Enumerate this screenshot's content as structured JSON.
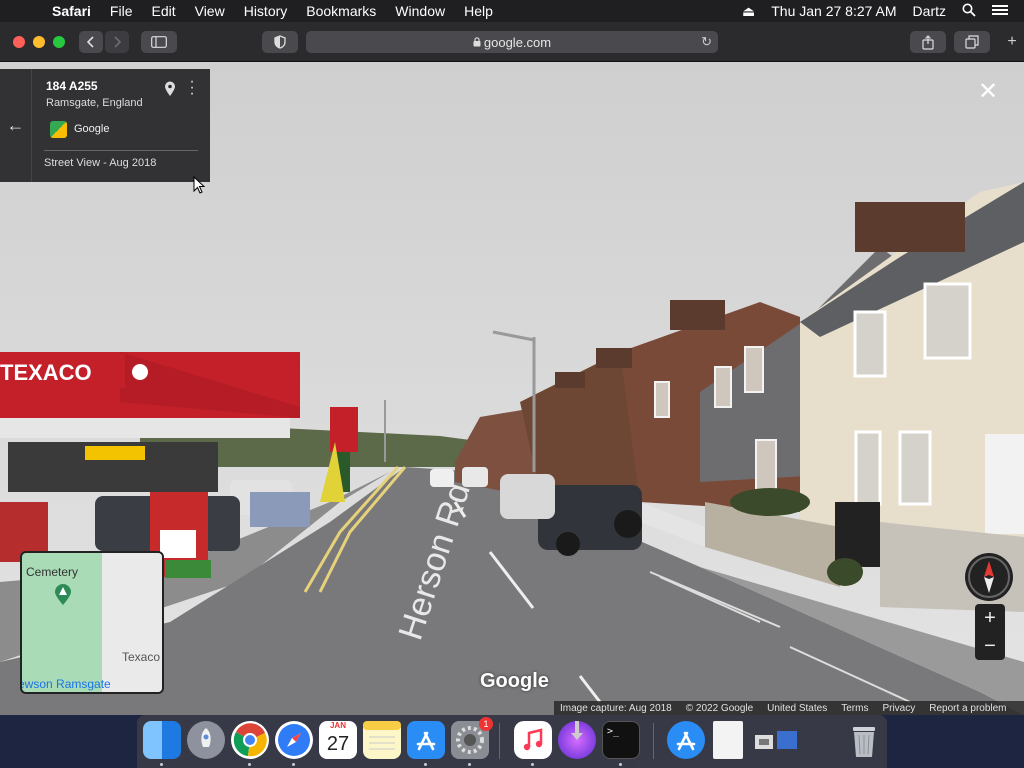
{
  "menubar": {
    "apple_icon": "apple-icon",
    "items": [
      "Safari",
      "File",
      "Edit",
      "View",
      "History",
      "Bookmarks",
      "Window",
      "Help"
    ],
    "datetime": "Thu Jan 27  8:27 AM",
    "user": "Dartz"
  },
  "browser": {
    "url": "google.com"
  },
  "streetview": {
    "place_title": "184 A255",
    "place_subtitle": "Ramsgate, England",
    "provider": "Google",
    "capture_label": "Street View - Aug 2018",
    "road_label": "Herson Rd",
    "sign_text": "TEXACO",
    "watermark": "Google",
    "minimap": {
      "label_cemetery": "Cemetery",
      "label_texaco": "Texaco",
      "label_ramsgate": "ewson Ramsgate"
    },
    "footer": [
      "Image capture: Aug 2018",
      "© 2022 Google",
      "United States",
      "Terms",
      "Privacy",
      "Report a problem"
    ],
    "zoom_in": "+",
    "zoom_out": "−",
    "close": "✕"
  },
  "dock": {
    "apps": [
      "finder-icon",
      "launchpad-icon",
      "chrome-icon",
      "safari-icon",
      "calendar-icon",
      "notes-icon",
      "app-store-icon",
      "system-preferences-icon",
      "music-icon",
      "downloads-icon",
      "terminal-icon",
      "app-store-folder-icon",
      "document-icon",
      "screenshots-icon",
      "trash-icon"
    ],
    "calendar_month": "JAN",
    "calendar_day": "27",
    "sysprefs_badge": "1"
  },
  "colors": {
    "sky": "#d6d6d6",
    "road": "#7a7a7c",
    "texaco_red": "#c4202a",
    "minimap_green": "#a9dbb7",
    "map_link": "#1a73e8"
  }
}
